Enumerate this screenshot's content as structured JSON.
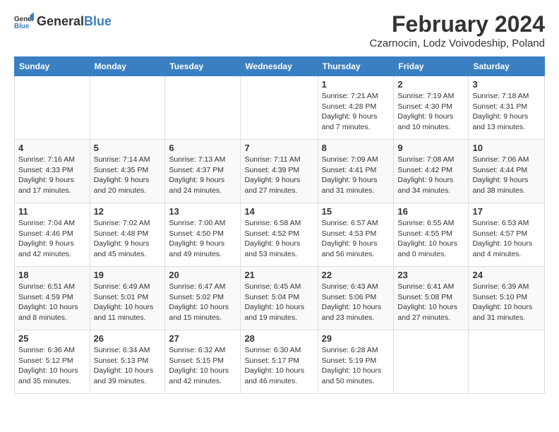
{
  "logo": {
    "text_general": "General",
    "text_blue": "Blue"
  },
  "header": {
    "title": "February 2024",
    "subtitle": "Czarnocin, Lodz Voivodeship, Poland"
  },
  "weekdays": [
    "Sunday",
    "Monday",
    "Tuesday",
    "Wednesday",
    "Thursday",
    "Friday",
    "Saturday"
  ],
  "weeks": [
    [
      {
        "day": "",
        "info": ""
      },
      {
        "day": "",
        "info": ""
      },
      {
        "day": "",
        "info": ""
      },
      {
        "day": "",
        "info": ""
      },
      {
        "day": "1",
        "info": "Sunrise: 7:21 AM\nSunset: 4:28 PM\nDaylight: 9 hours\nand 7 minutes."
      },
      {
        "day": "2",
        "info": "Sunrise: 7:19 AM\nSunset: 4:30 PM\nDaylight: 9 hours\nand 10 minutes."
      },
      {
        "day": "3",
        "info": "Sunrise: 7:18 AM\nSunset: 4:31 PM\nDaylight: 9 hours\nand 13 minutes."
      }
    ],
    [
      {
        "day": "4",
        "info": "Sunrise: 7:16 AM\nSunset: 4:33 PM\nDaylight: 9 hours\nand 17 minutes."
      },
      {
        "day": "5",
        "info": "Sunrise: 7:14 AM\nSunset: 4:35 PM\nDaylight: 9 hours\nand 20 minutes."
      },
      {
        "day": "6",
        "info": "Sunrise: 7:13 AM\nSunset: 4:37 PM\nDaylight: 9 hours\nand 24 minutes."
      },
      {
        "day": "7",
        "info": "Sunrise: 7:11 AM\nSunset: 4:39 PM\nDaylight: 9 hours\nand 27 minutes."
      },
      {
        "day": "8",
        "info": "Sunrise: 7:09 AM\nSunset: 4:41 PM\nDaylight: 9 hours\nand 31 minutes."
      },
      {
        "day": "9",
        "info": "Sunrise: 7:08 AM\nSunset: 4:42 PM\nDaylight: 9 hours\nand 34 minutes."
      },
      {
        "day": "10",
        "info": "Sunrise: 7:06 AM\nSunset: 4:44 PM\nDaylight: 9 hours\nand 38 minutes."
      }
    ],
    [
      {
        "day": "11",
        "info": "Sunrise: 7:04 AM\nSunset: 4:46 PM\nDaylight: 9 hours\nand 42 minutes."
      },
      {
        "day": "12",
        "info": "Sunrise: 7:02 AM\nSunset: 4:48 PM\nDaylight: 9 hours\nand 45 minutes."
      },
      {
        "day": "13",
        "info": "Sunrise: 7:00 AM\nSunset: 4:50 PM\nDaylight: 9 hours\nand 49 minutes."
      },
      {
        "day": "14",
        "info": "Sunrise: 6:58 AM\nSunset: 4:52 PM\nDaylight: 9 hours\nand 53 minutes."
      },
      {
        "day": "15",
        "info": "Sunrise: 6:57 AM\nSunset: 4:53 PM\nDaylight: 9 hours\nand 56 minutes."
      },
      {
        "day": "16",
        "info": "Sunrise: 6:55 AM\nSunset: 4:55 PM\nDaylight: 10 hours\nand 0 minutes."
      },
      {
        "day": "17",
        "info": "Sunrise: 6:53 AM\nSunset: 4:57 PM\nDaylight: 10 hours\nand 4 minutes."
      }
    ],
    [
      {
        "day": "18",
        "info": "Sunrise: 6:51 AM\nSunset: 4:59 PM\nDaylight: 10 hours\nand 8 minutes."
      },
      {
        "day": "19",
        "info": "Sunrise: 6:49 AM\nSunset: 5:01 PM\nDaylight: 10 hours\nand 11 minutes."
      },
      {
        "day": "20",
        "info": "Sunrise: 6:47 AM\nSunset: 5:02 PM\nDaylight: 10 hours\nand 15 minutes."
      },
      {
        "day": "21",
        "info": "Sunrise: 6:45 AM\nSunset: 5:04 PM\nDaylight: 10 hours\nand 19 minutes."
      },
      {
        "day": "22",
        "info": "Sunrise: 6:43 AM\nSunset: 5:06 PM\nDaylight: 10 hours\nand 23 minutes."
      },
      {
        "day": "23",
        "info": "Sunrise: 6:41 AM\nSunset: 5:08 PM\nDaylight: 10 hours\nand 27 minutes."
      },
      {
        "day": "24",
        "info": "Sunrise: 6:39 AM\nSunset: 5:10 PM\nDaylight: 10 hours\nand 31 minutes."
      }
    ],
    [
      {
        "day": "25",
        "info": "Sunrise: 6:36 AM\nSunset: 5:12 PM\nDaylight: 10 hours\nand 35 minutes."
      },
      {
        "day": "26",
        "info": "Sunrise: 6:34 AM\nSunset: 5:13 PM\nDaylight: 10 hours\nand 39 minutes."
      },
      {
        "day": "27",
        "info": "Sunrise: 6:32 AM\nSunset: 5:15 PM\nDaylight: 10 hours\nand 42 minutes."
      },
      {
        "day": "28",
        "info": "Sunrise: 6:30 AM\nSunset: 5:17 PM\nDaylight: 10 hours\nand 46 minutes."
      },
      {
        "day": "29",
        "info": "Sunrise: 6:28 AM\nSunset: 5:19 PM\nDaylight: 10 hours\nand 50 minutes."
      },
      {
        "day": "",
        "info": ""
      },
      {
        "day": "",
        "info": ""
      }
    ]
  ]
}
